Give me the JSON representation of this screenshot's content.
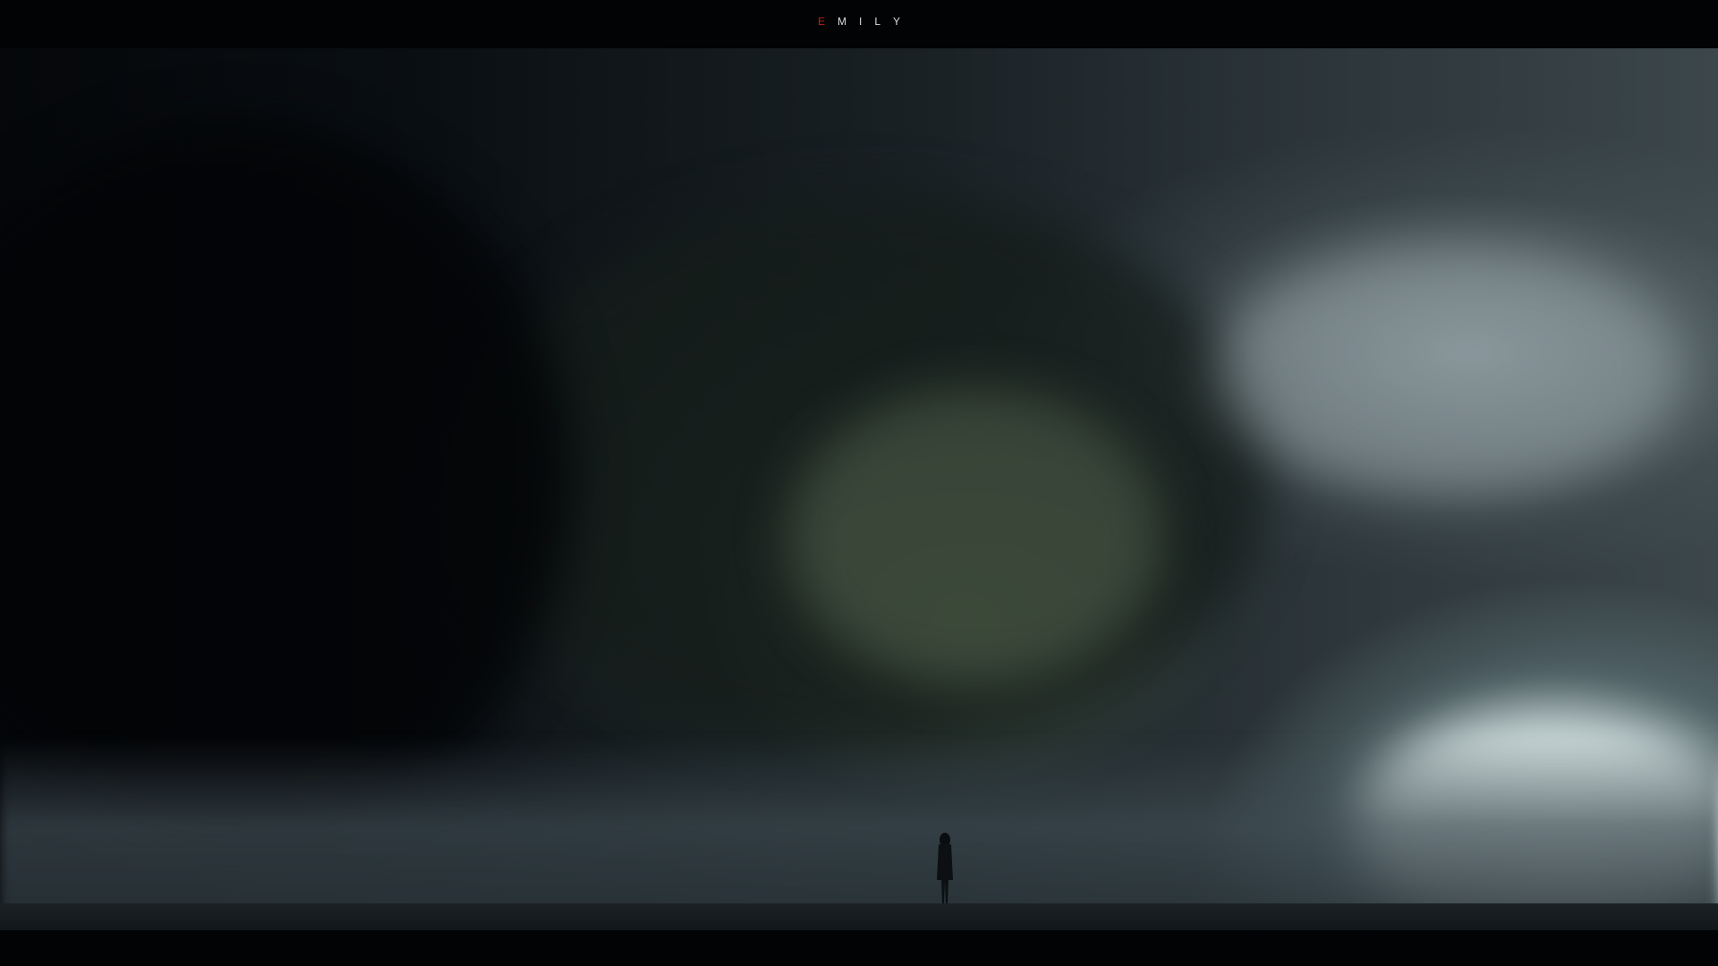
{
  "header": {
    "title_letters": [
      "E",
      "M",
      "I",
      "L",
      "Y"
    ],
    "accent_color": "#c31d1d",
    "text_color": "#d9dde0"
  },
  "scene": {
    "subject": "lone-figure-before-storm-cloud"
  }
}
